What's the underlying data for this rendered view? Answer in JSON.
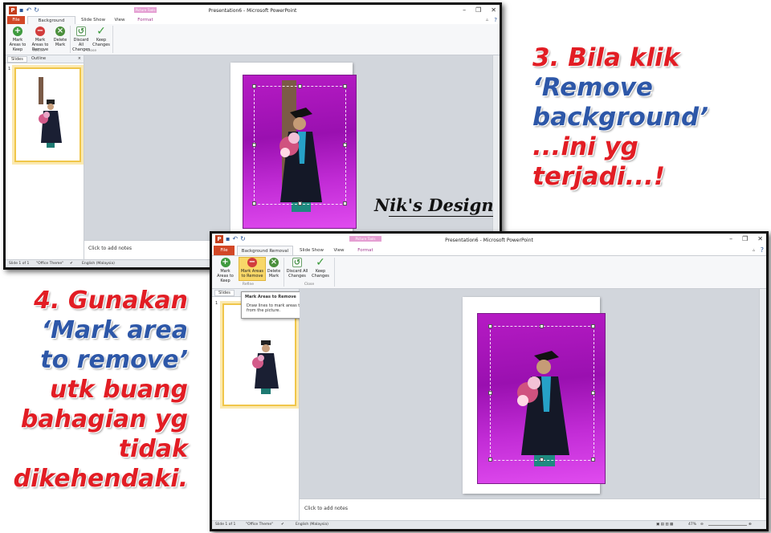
{
  "app_title": "Presentation6 - Microsoft PowerPoint",
  "context_tab_group": "Picture Tools",
  "tabs": {
    "file": "File",
    "background_removal": "Background Removal",
    "slide_show": "Slide Show",
    "view": "View",
    "format": "Format"
  },
  "ribbon": {
    "mark_keep": "Mark Areas to Keep",
    "mark_remove": "Mark Areas to Remove",
    "delete_mark": "Delete Mark",
    "group_refine": "Refine",
    "discard": "Discard All Changes",
    "keep": "Keep Changes",
    "group_close": "Close"
  },
  "panel": {
    "slides_tab": "Slides",
    "outline_tab": "Outline",
    "slide_number": "1"
  },
  "notes_placeholder": "Click to add notes",
  "tooltip": {
    "title": "Mark Areas to Remove",
    "body": "Draw lines to mark areas to remove from the picture."
  },
  "status": {
    "slide": "Slide 1 of 1",
    "theme": "\"Office Theme\"",
    "language": "English (Malaysia)",
    "zoom": "47%"
  },
  "captions": {
    "step3_line1": "3. Bila klik",
    "step3_line2": "‘Remove",
    "step3_line3": "background’",
    "step3_line4": "...ini yg",
    "step3_line5": "terjadi...!",
    "step4_line1": "4.  Gunakan",
    "step4_line2": "‘Mark area",
    "step4_line3": "to remove’",
    "step4_line4": "utk buang",
    "step4_line5": "bahagian yg",
    "step4_line6": "tidak",
    "step4_line7": "dikehendaki."
  },
  "watermark": "Nik's Design",
  "colors": {
    "caption_red": "#e21d24",
    "caption_blue": "#2d57a8",
    "file_tab": "#d24726",
    "photo_magenta": "#b61bc4"
  }
}
